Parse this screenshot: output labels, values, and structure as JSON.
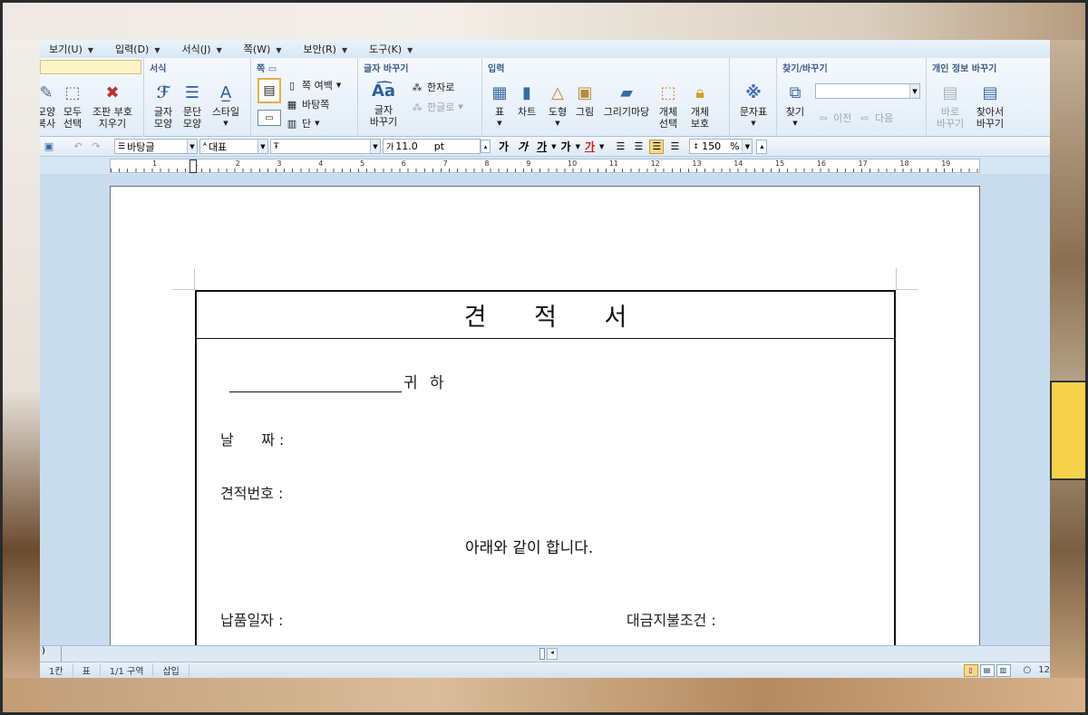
{
  "menubar": {
    "items": [
      {
        "label": "보기(U)"
      },
      {
        "label": "입력(D)"
      },
      {
        "label": "서식(J)"
      },
      {
        "label": "쪽(W)"
      },
      {
        "label": "보안(R)"
      },
      {
        "label": "도구(K)"
      }
    ]
  },
  "ribbon": {
    "clipboard": {
      "copy_format": "모양\n복사",
      "select_all": "모두\n선택",
      "erase_marks": "조판 부호\n지우기"
    },
    "format": {
      "title": "서식",
      "char_shape": "글자\n모양",
      "para_shape": "문단\n모양",
      "style": "스타일"
    },
    "page": {
      "title": "쪽",
      "margin": "쪽 여백",
      "master": "바탕쪽",
      "columns": "단"
    },
    "convert": {
      "title": "글자 바꾸기",
      "convert_btn": "글자\n바꾸기",
      "hanja": "한자로",
      "hangul": "한글로"
    },
    "insert": {
      "title": "입력",
      "table": "표",
      "chart": "차트",
      "shape": "도형",
      "picture": "그림",
      "gallery": "그리기마당",
      "obj_select": "개체\n선택",
      "obj_protect": "개체\n보호"
    },
    "charmap": {
      "label": "문자표"
    },
    "find": {
      "title": "찾기/바꾸기",
      "find_btn": "찾기",
      "prev": "이전",
      "next": "다음",
      "search_value": ""
    },
    "privacy": {
      "title": "개인 정보 바꾸기",
      "direct": "바로\n바꾸기",
      "find_replace": "찾아서\n바꾸기"
    }
  },
  "toolbar2": {
    "style": "바탕글",
    "lang": "대표",
    "font": "",
    "size": "11.0",
    "unit": "pt",
    "zoom": "150",
    "zoom_unit": "%",
    "bold": "가",
    "italic": "가",
    "underline": "가",
    "strike": "가",
    "color": "가"
  },
  "ruler": {
    "numbers": [
      "1",
      "1",
      "2",
      "3",
      "4",
      "5",
      "6",
      "7",
      "8",
      "9",
      "10",
      "11",
      "12",
      "13",
      "14",
      "15",
      "16",
      "17",
      "18",
      "19"
    ]
  },
  "document": {
    "title": "견 적 서",
    "addressee_suffix": "귀 하",
    "date_label": "날      짜 :",
    "quote_no_label": "견적번호 :",
    "intro": "아래와 같이 합니다.",
    "delivery_label": "납품일자 :",
    "payment_label": "대금지불조건 :"
  },
  "statusbar": {
    "line_col": "1칸",
    "section_label": "표",
    "section": "1/1 구역",
    "mode": "삽입",
    "zoom_partial": "12"
  },
  "colors": {
    "accent": "#3a5c85",
    "ribbon_bg": "#e2edf8",
    "app_bg": "#d6e6f4"
  }
}
